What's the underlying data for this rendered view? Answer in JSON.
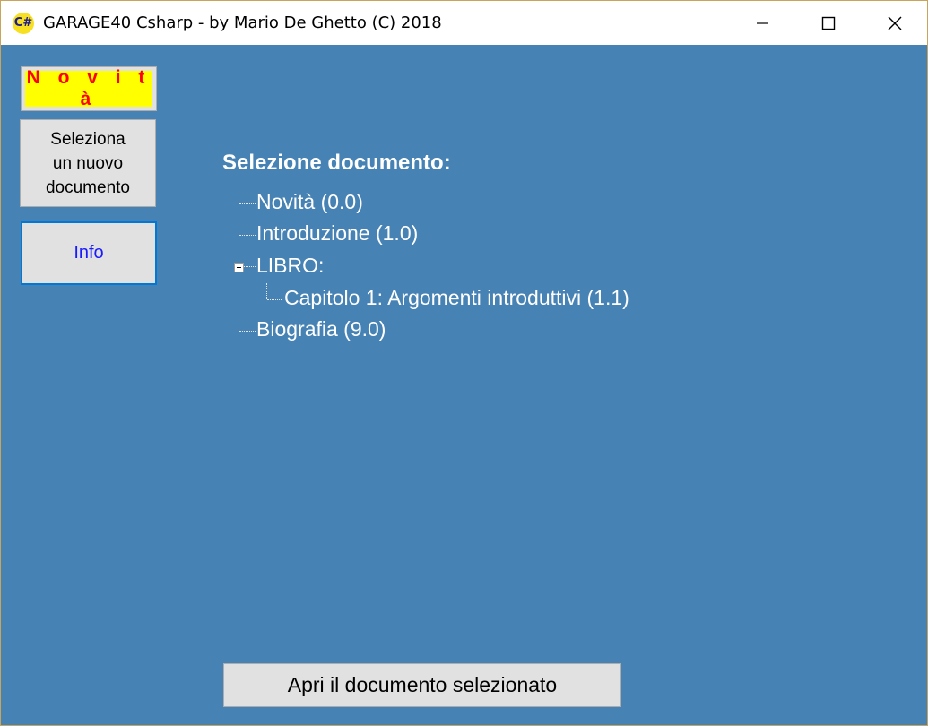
{
  "window": {
    "title": "GARAGE40 Csharp - by Mario De Ghetto (C) 2018",
    "icon_label": "C#",
    "controls": [
      "minimize-icon",
      "maximize-icon",
      "close-icon"
    ]
  },
  "sidebar": {
    "novita_label": "N o v i t à",
    "seleziona_lines": [
      "Seleziona",
      "un nuovo",
      "documento"
    ],
    "info_label": "Info"
  },
  "main": {
    "heading": "Selezione documento:",
    "tree": [
      {
        "label": "Novità  (0.0)",
        "level": 0
      },
      {
        "label": "Introduzione  (1.0)",
        "level": 0
      },
      {
        "label": "LIBRO:",
        "level": 0,
        "expanded": true
      },
      {
        "label": "Capitolo 1: Argomenti introduttivi  (1.1)",
        "level": 1
      },
      {
        "label": "Biografia  (9.0)",
        "level": 0
      }
    ],
    "open_button": "Apri il documento selezionato"
  },
  "colors": {
    "background": "#4682b4",
    "novita_bg": "#ffff00",
    "novita_text": "#ff0000",
    "info_text": "#1a1aff",
    "focus_border": "#0078d7"
  }
}
